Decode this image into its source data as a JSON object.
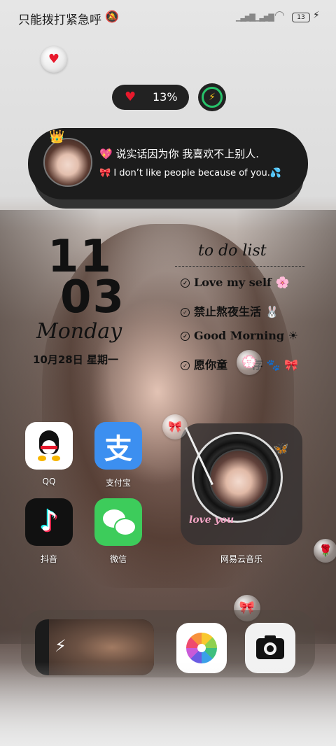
{
  "status_bar": {
    "carrier_text": "只能拨打紧急呼",
    "bell_icon": "bell-off-icon",
    "battery_level": "13"
  },
  "battery_widget": {
    "percent": "13%"
  },
  "quote_card": {
    "line_cn": "说实话因为你 我喜欢不上别人.",
    "line_en": "I don’t like people because of you."
  },
  "clock": {
    "hour": "11",
    "minute": "03",
    "weekday": "Monday",
    "date": "10月28日 星期一"
  },
  "todo": {
    "title": "to do list",
    "items": [
      "Love my self",
      "禁止熬夜生活",
      "Good Morning",
      "愿你童",
      "存"
    ]
  },
  "apps": {
    "qq": "QQ",
    "alipay": "支付宝",
    "alipay_glyph": "支",
    "douyin": "抖音",
    "wechat": "微信",
    "music": "网易云音乐"
  },
  "music_widget": {
    "caption": "love you"
  }
}
